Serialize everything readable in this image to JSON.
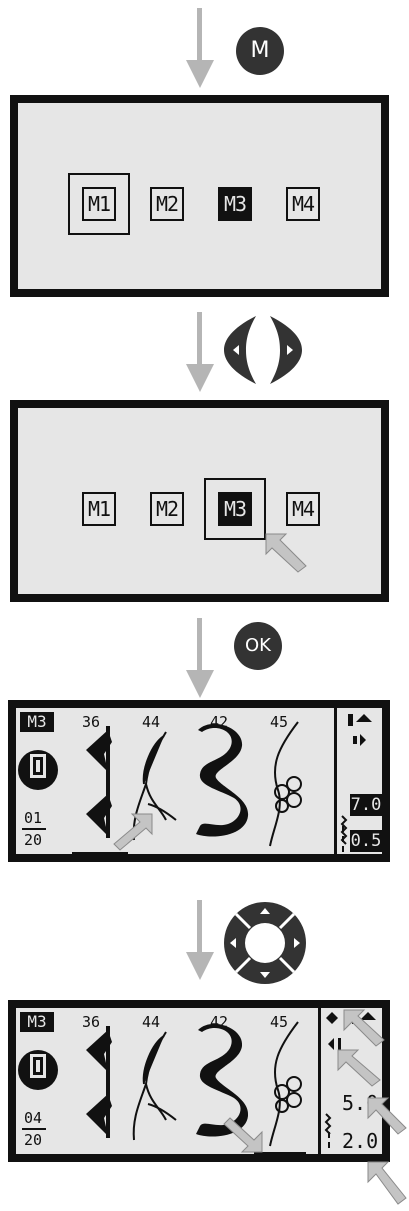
{
  "step1": {
    "button_label": "M",
    "memories": [
      "M1",
      "M2",
      "M3",
      "M4"
    ],
    "framed": "M1",
    "highlighted": "M3"
  },
  "step2": {
    "memories": [
      "M1",
      "M2",
      "M3",
      "M4"
    ],
    "framed": "M3",
    "highlighted": "M3"
  },
  "step3": {
    "button_label": "OK",
    "memory_label": "M3",
    "stitch_numbers": [
      "36",
      "44",
      "42",
      "45"
    ],
    "counter_top": "01",
    "counter_bottom": "20",
    "stitch_length": "7.0",
    "stitch_width": "0.5"
  },
  "step4": {
    "memory_label": "M3",
    "stitch_numbers": [
      "36",
      "44",
      "42",
      "45"
    ],
    "counter_top": "04",
    "counter_bottom": "20",
    "stitch_length": "5.0",
    "stitch_width": "2.0"
  },
  "colors": {
    "lcd": "#e6e6e6",
    "frame": "#111111",
    "arrow": "#b5b5b5",
    "button": "#333333"
  }
}
